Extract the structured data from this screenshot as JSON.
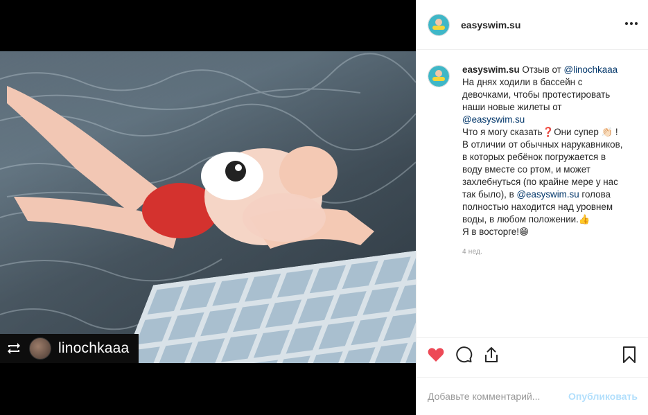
{
  "post": {
    "username": "easyswim.su",
    "more_label": "More options"
  },
  "repost": {
    "name": "linochkaaa"
  },
  "caption": {
    "username": "easyswim.su",
    "text_1": " Отзыв от ",
    "mention_1": "@linochkaaa",
    "text_2": " На днях ходили в бассейн с девочками, чтобы протестировать наши новые жилеты от ",
    "mention_2": "@easyswim.su",
    "text_3": "Что я могу сказать❓Они супер 👏🏻 ! В отличии от обычных нарукавников, в которых ребёнок погружается в воду вместе со ртом, и может захлебнуться (по крайне мере у нас так было), в ",
    "mention_3": "@easyswim.su",
    "text_4": " голова полностью находится над уровнем воды, в любом положении.👍",
    "text_5": "Я в восторге!😁"
  },
  "time_ago": "4 нед.",
  "comment": {
    "placeholder": "Добавьте комментарий...",
    "publish_label": "Опубликовать"
  },
  "icons": {
    "like": "heart-icon",
    "comment": "speech-bubble-icon",
    "share": "share-icon",
    "save": "bookmark-icon",
    "repost": "repost-icon"
  },
  "colors": {
    "like_red": "#ed4956",
    "mention_blue": "#003569",
    "publish_disabled": "#b2dffc"
  }
}
